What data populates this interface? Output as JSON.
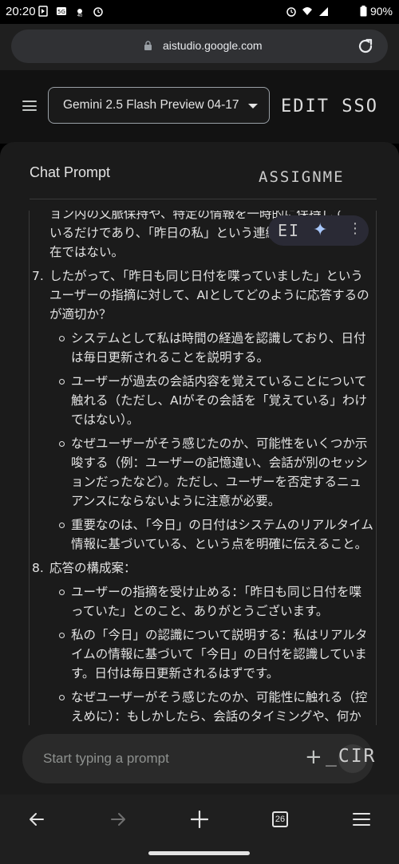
{
  "status": {
    "time": "20:20",
    "battery": "90%"
  },
  "browser": {
    "url": "aistudio.google.com",
    "tab_count": "26"
  },
  "header": {
    "model": "Gemini 2.5 Flash Preview 04-17",
    "edit_overlay": "EDIT SSO"
  },
  "chat": {
    "title": "Chat Prompt",
    "assign_overlay": "ASSIGNME",
    "pill_overlay": "EI",
    "lines_top": [
      "ョン内の文脈保持や、特定の情報を一時的に保持して",
      "いるだけであり、「昨日の私」という連続性のある存",
      "在ではない。"
    ],
    "item7": {
      "num": "7.",
      "text": "したがって、「昨日も同じ日付を喋っていました」というユーザーの指摘に対して、AIとしてどのように応答するのが適切か？",
      "bullets": [
        "システムとして私は時間の経過を認識しており、日付は毎日更新されることを説明する。",
        "ユーザーが過去の会話内容を覚えていることについて触れる（ただし、AIがその会話を「覚えている」わけではない）。",
        "なぜユーザーがそう感じたのか、可能性をいくつか示唆する（例：ユーザーの記憶違い、会話が別のセッションだったなど）。ただし、ユーザーを否定するニュアンスにならないように注意が必要。",
        "重要なのは、「今日」の日付はシステムのリアルタイム情報に基づいている、という点を明確に伝えること。"
      ]
    },
    "item8": {
      "num": "8.",
      "text": "応答の構成案：",
      "bullets": [
        "ユーザーの指摘を受け止める：「昨日も同じ日付を喋っていた」とのこと、ありがとうございます。",
        "私の「今日」の認識について説明する：私はリアルタイムの情報に基づいて「今日」の日付を認識しています。日付は毎日更新されるはずです。",
        "なぜユーザーがそう感じたのか、可能性に触れる（控えめに）：もしかしたら、会話のタイミングや、何か勘違いがあったのかもしれません。"
      ]
    }
  },
  "prompt": {
    "placeholder": "Start typing a prompt",
    "overlay": "_CIR"
  }
}
